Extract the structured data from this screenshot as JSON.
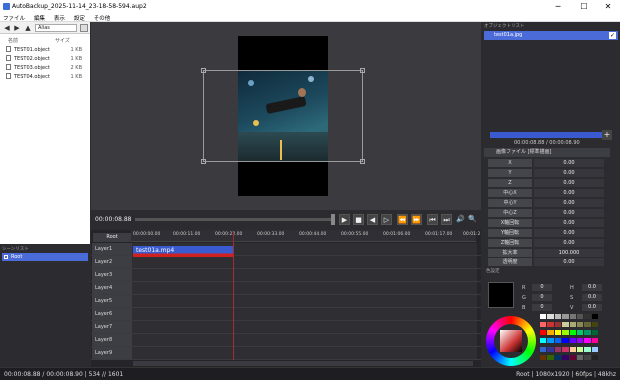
{
  "window": {
    "title": "AutoBackup_2025-11-14_23-18-58-594.aup2",
    "minimize": "─",
    "maximize": "☐",
    "close": "✕"
  },
  "menu": [
    "ファイル",
    "編集",
    "表示",
    "設定",
    "その他"
  ],
  "explorer": {
    "back": "◀",
    "forward": "▶",
    "up": "▲",
    "address": "Alias",
    "col_name": "名前",
    "col_size": "サイズ",
    "files": [
      {
        "name": "TEST01.object",
        "size": "1 KB"
      },
      {
        "name": "TEST02.object",
        "size": "1 KB"
      },
      {
        "name": "TEST03.object",
        "size": "2 KB"
      },
      {
        "name": "TEST04.object",
        "size": "1 KB"
      }
    ]
  },
  "scene_list": {
    "label": "シーンリスト",
    "items": [
      "Root"
    ]
  },
  "player": {
    "timecode": "00:00:08.88",
    "buttons": [
      "▶",
      "■",
      "◀",
      "▷",
      "⏪",
      "⏩",
      "⏮",
      "⏭",
      "🔊",
      "🔍"
    ]
  },
  "timeline": {
    "root_label": "Root",
    "ticks": [
      "00:00:00.00",
      "00:00:11.00",
      "00:00:22.00",
      "00:00:33.00",
      "00:00:44.00",
      "00:00:55.00",
      "00:01:06.00",
      "00:01:17.00",
      "00:01:2"
    ],
    "layers": [
      "Layer1",
      "Layer2",
      "Layer3",
      "Layer4",
      "Layer5",
      "Layer6",
      "Layer7",
      "Layer8",
      "Layer9"
    ],
    "clip": "test01a.mp4"
  },
  "objects": {
    "label": "オブジェクトリスト",
    "item": "test01a.jpg"
  },
  "properties": {
    "time": "00:00:08.88 / 00:00:08.90",
    "filter": "画像ファイル [標準描画]",
    "rows": [
      {
        "label": "X",
        "value": "0.00"
      },
      {
        "label": "Y",
        "value": "0.00"
      },
      {
        "label": "Z",
        "value": "0.00"
      },
      {
        "label": "中心X",
        "value": "0.00"
      },
      {
        "label": "中心Y",
        "value": "0.00"
      },
      {
        "label": "中心Z",
        "value": "0.00"
      },
      {
        "label": "X軸回転",
        "value": "0.00"
      },
      {
        "label": "Y軸回転",
        "value": "0.00"
      },
      {
        "label": "Z軸回転",
        "value": "0.00"
      },
      {
        "label": "拡大率",
        "value": "100.000"
      },
      {
        "label": "透明度",
        "value": "0.00"
      }
    ]
  },
  "color": {
    "label": "色設定",
    "r": "R",
    "g": "G",
    "b": "B",
    "h": "H",
    "s": "S",
    "v": "V",
    "rv": "0",
    "gv": "0",
    "bv": "0",
    "hv": "0.0",
    "sv": "0.0",
    "vv": "0.0"
  },
  "status": {
    "left": "00:00:08.88 / 00:00:08.90 | 534 // 1601",
    "right": "Root | 1080x1920 | 60fps | 48khz"
  }
}
